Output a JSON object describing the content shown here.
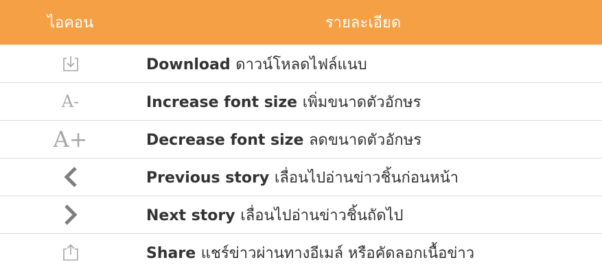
{
  "header": {
    "icon_col": "ไอคอน",
    "desc_col": "รายละเอียด"
  },
  "rows": [
    {
      "icon": "download-icon",
      "name": "Download",
      "desc": "ดาวน์โหลดไฟล์แนบ"
    },
    {
      "icon": "font-size-decrease-icon",
      "glyph": "A-",
      "name": "Increase font size",
      "desc": "เพิ่มขนาดตัวอักษร"
    },
    {
      "icon": "font-size-increase-icon",
      "glyph": "A+",
      "name": "Decrease font size",
      "desc": "ลดขนาดตัวอักษร"
    },
    {
      "icon": "chevron-left-icon",
      "name": "Previous story",
      "desc": "เลื่อนไปอ่านข่าวชิ้นก่อนหน้า"
    },
    {
      "icon": "chevron-right-icon",
      "name": "Next story",
      "desc": "เลื่อนไปอ่านข่าวชิ้นถัดไป"
    },
    {
      "icon": "share-icon",
      "name": "Share",
      "desc": "แชร์ข่าวผ่านทางอีเมล์ หรือคัดลอกเนื้อข่าว"
    }
  ],
  "colors": {
    "header_bg": "#f5a045",
    "header_text": "#ffffff",
    "row_text": "#333333",
    "icon_gray": "#a7a7a7",
    "chevron_gray": "#7f7f7f",
    "divider": "#dcdcdc"
  }
}
